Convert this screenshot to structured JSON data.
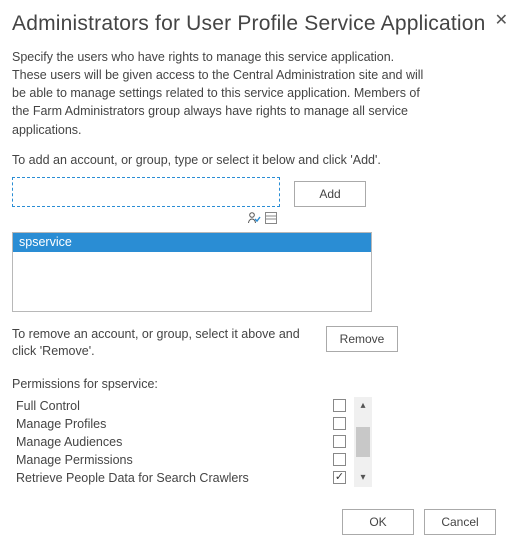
{
  "dialog": {
    "title": "Administrators for User Profile Service Application",
    "description": "Specify the users who have rights to manage this service application. These users will be given access to the Central Administration site and will be able to manage settings related to this service application. Members of the Farm Administrators group always have rights to manage all service applications.",
    "add_instruction": "To add an account, or group, type or select it below and click 'Add'.",
    "account_input_value": "",
    "add_label": "Add",
    "selected_account": "spservice",
    "remove_instruction": "To remove an account, or group, select it above and click 'Remove'.",
    "remove_label": "Remove",
    "permissions_title": "Permissions for spservice:",
    "permissions": [
      {
        "label": "Full Control",
        "checked": false
      },
      {
        "label": "Manage Profiles",
        "checked": false
      },
      {
        "label": "Manage Audiences",
        "checked": false
      },
      {
        "label": "Manage Permissions",
        "checked": false
      },
      {
        "label": "Retrieve People Data for Search Crawlers",
        "checked": true
      }
    ],
    "ok_label": "OK",
    "cancel_label": "Cancel"
  }
}
